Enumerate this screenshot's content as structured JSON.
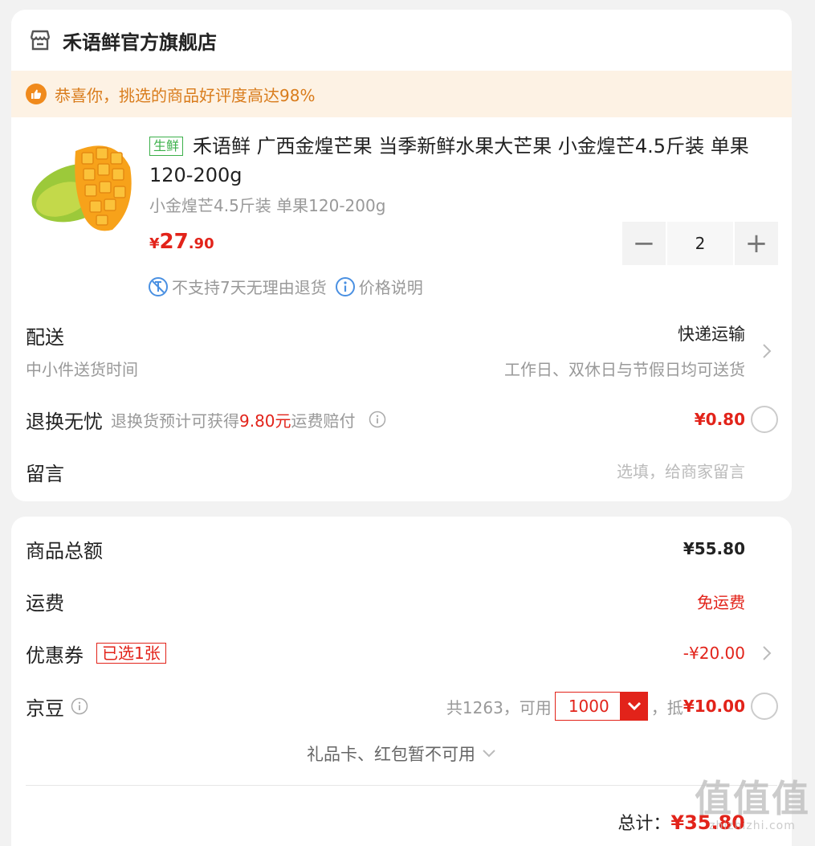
{
  "shop": {
    "name": "禾语鲜官方旗舰店",
    "icon": "store-icon"
  },
  "banner": {
    "text": "恭喜你，挑选的商品好评度高达98%",
    "icon": "thumbs-up-icon"
  },
  "product": {
    "tag": "生鲜",
    "title": "禾语鲜 广西金煌芒果 当季新鲜水果大芒果 小金煌芒4.5斤装 单果120-200g",
    "spec": "小金煌芒4.5斤装 单果120-200g",
    "price_currency": "¥",
    "price_int": "27",
    "price_dec": ".90",
    "quantity": "2",
    "minus": "−",
    "plus": "+",
    "note_return": "不支持7天无理由退货",
    "note_price": "价格说明"
  },
  "delivery": {
    "label": "配送",
    "sub": "中小件送货时间",
    "type": "快递运输",
    "time": "工作日、双休日与节假日均可送货"
  },
  "returns": {
    "label": "退换无忧",
    "desc_pre": "退换货预计可获得",
    "desc_amount": "9.80元",
    "desc_post": "运费赔付",
    "fee": "¥0.80"
  },
  "message": {
    "label": "留言",
    "placeholder": "选填，给商家留言"
  },
  "summary": {
    "goods_label": "商品总额",
    "goods_value": "¥55.80",
    "shipping_label": "运费",
    "shipping_value": "免运费",
    "coupon_label": "优惠券",
    "coupon_tag": "已选1张",
    "coupon_value": "-¥20.00",
    "beans_label": "京豆",
    "beans_total": "共1263，可用",
    "beans_selected": "1000",
    "beans_deduct_pre": "，抵",
    "beans_deduct": "¥10.00",
    "unavailable": "礼品卡、红包暂不可用",
    "total_label": "总计：",
    "total_value": "¥35.80"
  },
  "watermark": {
    "big": "值值值",
    "small": "zhizhizhi.com"
  },
  "colors": {
    "accent": "#e2231a",
    "fresh": "#3cb04a",
    "banner_bg": "#fdf2e4",
    "banner_text": "#d97c1c"
  }
}
